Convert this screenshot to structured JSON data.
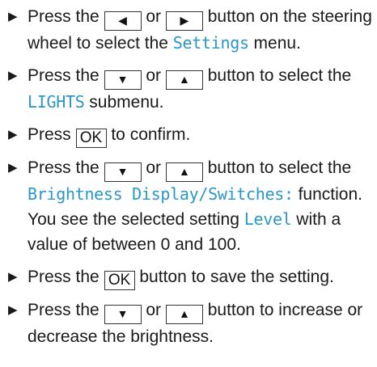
{
  "steps": [
    {
      "parts": [
        {
          "t": "Press the "
        },
        {
          "k": "arrow",
          "v": "◀",
          "name": "left-arrow-key"
        },
        {
          "t": " or "
        },
        {
          "k": "arrow",
          "v": "▶",
          "name": "right-arrow-key"
        },
        {
          "t": " button on the steering wheel to select the "
        },
        {
          "h": "Settings"
        },
        {
          "t": " menu."
        }
      ]
    },
    {
      "parts": [
        {
          "t": "Press the "
        },
        {
          "k": "arrow",
          "v": "▼",
          "name": "down-arrow-key"
        },
        {
          "t": " or "
        },
        {
          "k": "arrow",
          "v": "▲",
          "name": "up-arrow-key"
        },
        {
          "t": " button to select the "
        },
        {
          "h": "LIGHTS"
        },
        {
          "t": " submenu."
        }
      ]
    },
    {
      "parts": [
        {
          "t": "Press "
        },
        {
          "k": "ok",
          "v": "OK",
          "name": "ok-key"
        },
        {
          "t": " to confirm."
        }
      ]
    },
    {
      "parts": [
        {
          "t": "Press the "
        },
        {
          "k": "arrow",
          "v": "▼",
          "name": "down-arrow-key"
        },
        {
          "t": " or "
        },
        {
          "k": "arrow",
          "v": "▲",
          "name": "up-arrow-key"
        },
        {
          "t": " button to select the "
        },
        {
          "h": "Brightness Display/Switches:"
        },
        {
          "t": " function."
        }
      ],
      "note": [
        {
          "t": "You see the selected setting "
        },
        {
          "h": "Level"
        },
        {
          "t": " with a value of between 0 and 100."
        }
      ]
    },
    {
      "parts": [
        {
          "t": "Press the "
        },
        {
          "k": "ok",
          "v": "OK",
          "name": "ok-key"
        },
        {
          "t": " button to save the setting."
        }
      ]
    },
    {
      "parts": [
        {
          "t": "Press the "
        },
        {
          "k": "arrow",
          "v": "▼",
          "name": "down-arrow-key"
        },
        {
          "t": " or "
        },
        {
          "k": "arrow",
          "v": "▲",
          "name": "up-arrow-key"
        },
        {
          "t": " button to increase or decrease the brightness."
        }
      ]
    }
  ],
  "bullet": "▶",
  "colors": {
    "highlight": "#2a97c8",
    "text": "#1a1a1a"
  }
}
